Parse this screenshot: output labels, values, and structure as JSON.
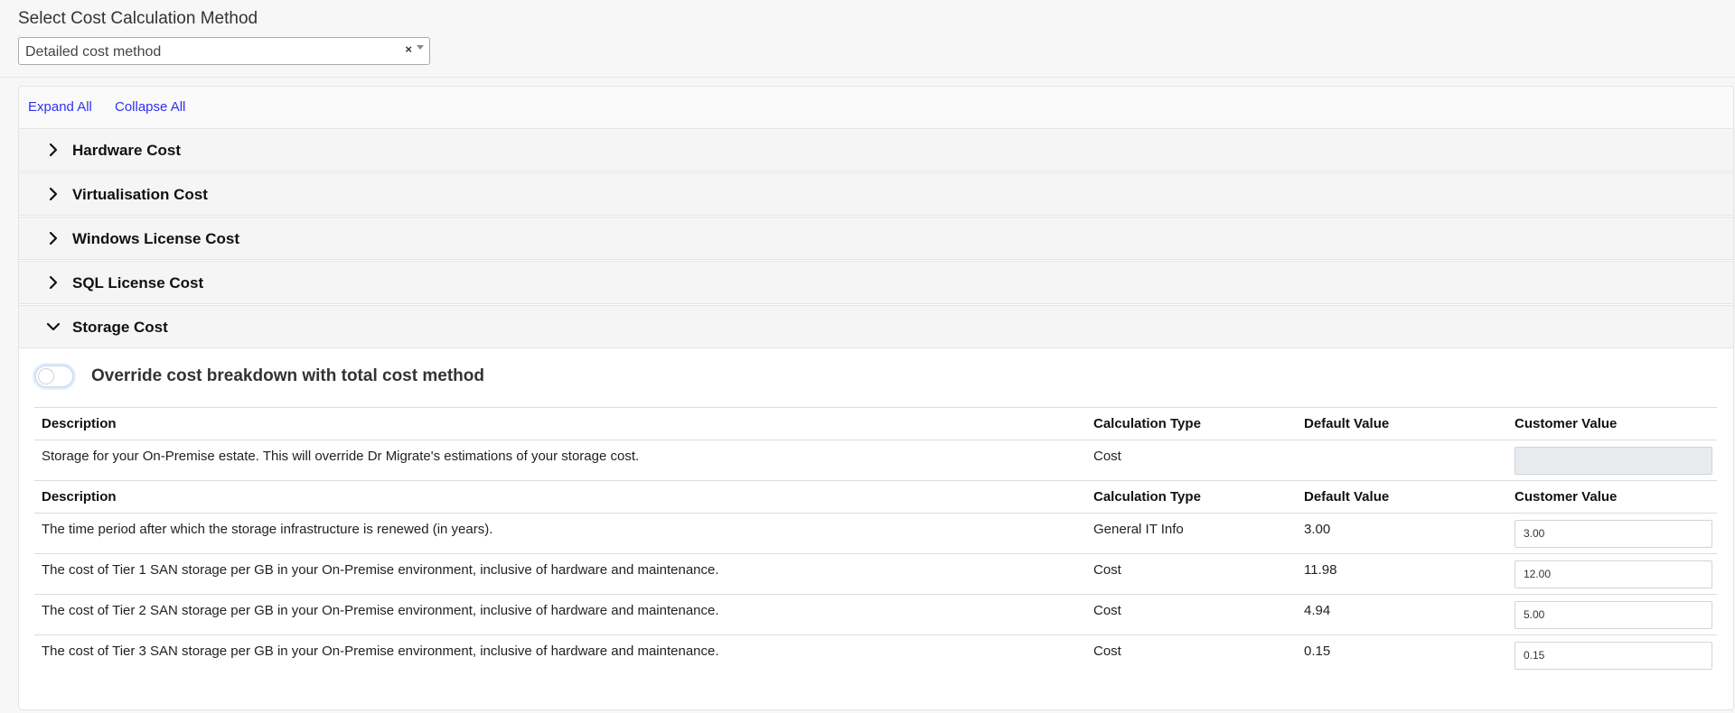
{
  "method": {
    "label": "Select Cost Calculation Method",
    "selected": "Detailed cost method",
    "clear_symbol": "×"
  },
  "links": {
    "expand_all": "Expand All",
    "collapse_all": "Collapse All"
  },
  "sections": [
    {
      "title": "Hardware Cost",
      "expanded": false
    },
    {
      "title": "Virtualisation Cost",
      "expanded": false
    },
    {
      "title": "Windows License Cost",
      "expanded": false
    },
    {
      "title": "SQL License Cost",
      "expanded": false
    },
    {
      "title": "Storage Cost",
      "expanded": true
    }
  ],
  "storage": {
    "override_label": "Override cost breakdown with total cost method",
    "override_on": false,
    "headers": {
      "description": "Description",
      "calc_type": "Calculation Type",
      "default_value": "Default Value",
      "customer_value": "Customer Value"
    },
    "total_row": {
      "description": "Storage for your On-Premise estate. This will override Dr Migrate's estimations of your storage cost.",
      "calc_type": "Cost",
      "default_value": "",
      "customer_value": ""
    },
    "rows": [
      {
        "description": "The time period after which the storage infrastructure is renewed (in years).",
        "calc_type": "General IT Info",
        "default_value": "3.00",
        "customer_value": "3.00"
      },
      {
        "description": "The cost of Tier 1 SAN storage per GB in your On-Premise environment, inclusive of hardware and maintenance.",
        "calc_type": "Cost",
        "default_value": "11.98",
        "customer_value": "12.00"
      },
      {
        "description": "The cost of Tier 2 SAN storage per GB in your On-Premise environment, inclusive of hardware and maintenance.",
        "calc_type": "Cost",
        "default_value": "4.94",
        "customer_value": "5.00"
      },
      {
        "description": "The cost of Tier 3 SAN storage per GB in your On-Premise environment, inclusive of hardware and maintenance.",
        "calc_type": "Cost",
        "default_value": "0.15",
        "customer_value": "0.15"
      }
    ]
  },
  "colors": {
    "link": "#2f32f0",
    "header_bg": "#f5f5f5",
    "disabled_input_bg": "#e9ecef"
  }
}
